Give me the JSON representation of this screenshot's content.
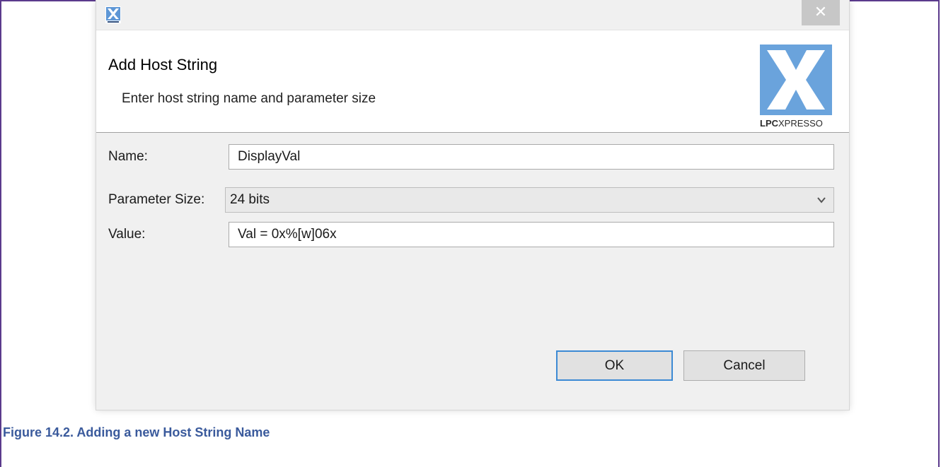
{
  "dialog": {
    "app_icon": "lpcxpresso-x-icon",
    "close_label": "✕",
    "title": "Add Host String",
    "subtitle": "Enter host string name and parameter size",
    "brand_text_bold": "LPC",
    "brand_text_light": "XPRESSO"
  },
  "form": {
    "name_label": "Name:",
    "name_value": "DisplayVal",
    "param_size_label": "Parameter Size:",
    "param_size_value": "24 bits",
    "value_label": "Value:",
    "value_value": "Val = 0x%[w]06x"
  },
  "buttons": {
    "ok_label": "OK",
    "cancel_label": "Cancel"
  },
  "caption": "Figure 14.2. Adding a new Host String Name",
  "colors": {
    "page_border": "#5b3a8c",
    "brand_blue": "#6aa3dc",
    "caption": "#3a5a9c",
    "ok_focus": "#3c8ad4"
  }
}
